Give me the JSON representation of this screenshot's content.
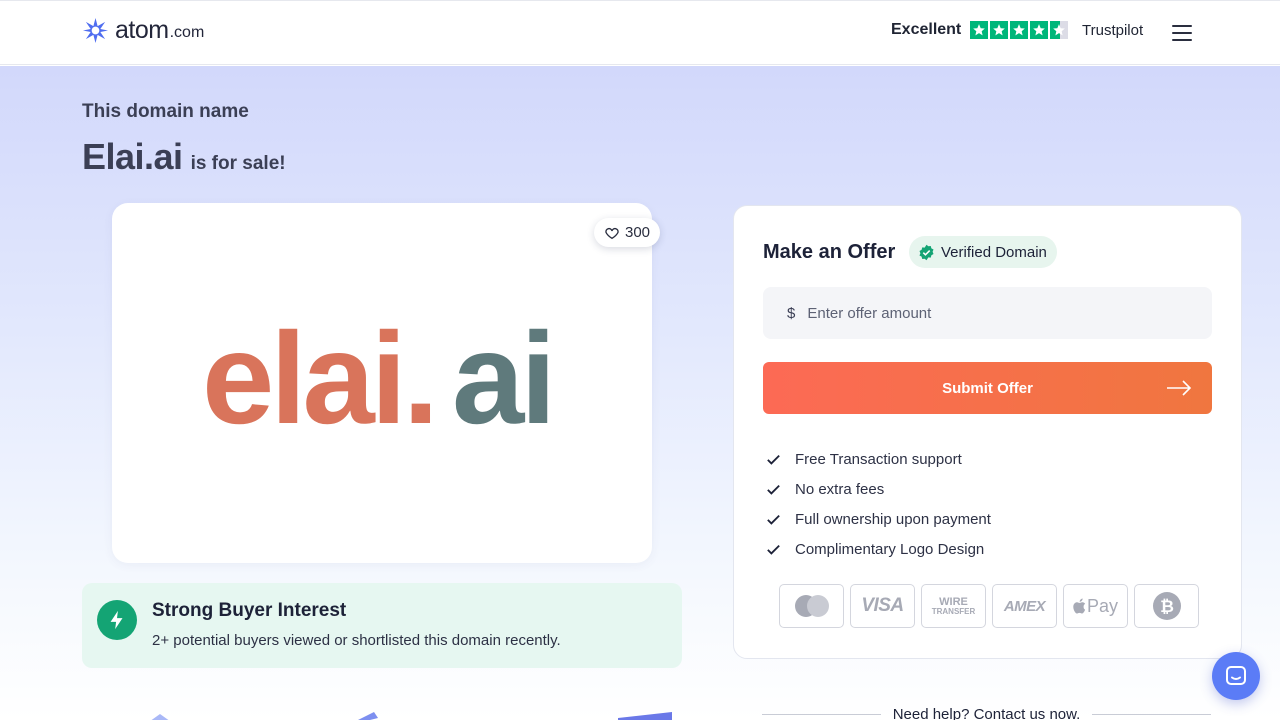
{
  "header": {
    "logo_text": "atom",
    "logo_suffix": ".com",
    "rating_label": "Excellent",
    "rating_stars": 4.5,
    "trustpilot_label": "Trustpilot"
  },
  "hero": {
    "eyebrow": "This domain name",
    "domain": "Elai.ai",
    "suffix": "is for sale!",
    "logo_text_main": "elai.",
    "logo_text_tld": "ai",
    "likes": "300"
  },
  "interest": {
    "title": "Strong Buyer Interest",
    "text": "2+ potential buyers viewed or shortlisted this domain recently."
  },
  "offer": {
    "title": "Make an Offer",
    "verified_label": "Verified Domain",
    "currency": "$",
    "placeholder": "Enter offer amount",
    "submit_label": "Submit Offer",
    "benefits": [
      "Free Transaction support",
      "No extra fees",
      "Full ownership upon payment",
      "Complimentary Logo Design"
    ],
    "payment_methods": [
      "mastercard-icon",
      "VISA",
      "WIRE TRANSFER",
      "AMEX",
      "Pay",
      "bitcoin-icon"
    ],
    "wire_line1": "WIRE",
    "wire_line2": "TRANSFER"
  },
  "help": {
    "text": "Need help? Contact us now."
  },
  "colors": {
    "accent_orange": "#fc6a55",
    "trustpilot_green": "#00b67a",
    "interest_green": "#14a474",
    "chat_blue": "#5b7cf6",
    "logo_orange": "#d9745b",
    "logo_slate": "#5f7a7c"
  }
}
